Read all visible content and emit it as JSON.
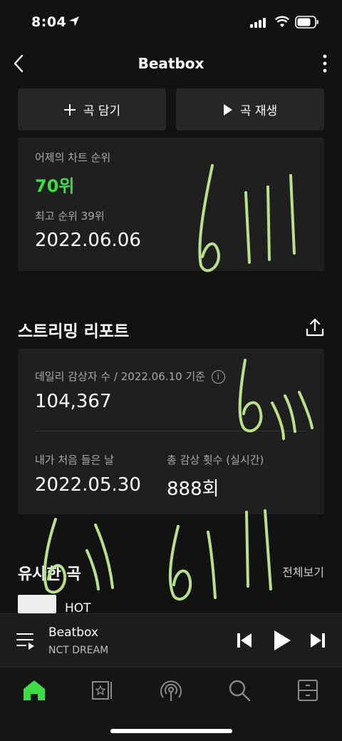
{
  "status_bar": {
    "time": "8:04"
  },
  "nav": {
    "title": "Beatbox"
  },
  "actions": {
    "add_label": "곡 담기",
    "play_label": "곡 재생"
  },
  "chart": {
    "yesterday_label": "어제의 차트 순위",
    "yesterday_rank": "70위",
    "best_label": "최고 순위 39위",
    "best_date": "2022.06.06"
  },
  "report": {
    "title": "스트리밍 리포트",
    "daily_label": "데일리 감상자 수 / 2022.06.10 기준",
    "daily_value": "104,367",
    "first_listen_label": "내가 처음 들은 날",
    "first_listen_value": "2022.05.30",
    "total_label": "총 감상 횟수 (실시간)",
    "total_value": "888회"
  },
  "similar": {
    "title": "유사한 곡",
    "see_all": "전체보기",
    "items": [
      {
        "title": "HOT"
      }
    ]
  },
  "player": {
    "title": "Beatbox",
    "artist": "NCT DREAM"
  },
  "colors": {
    "accent": "#3ddc46",
    "background": "#121212",
    "card": "#1f1f1f",
    "scribble": "#b9e08a"
  }
}
